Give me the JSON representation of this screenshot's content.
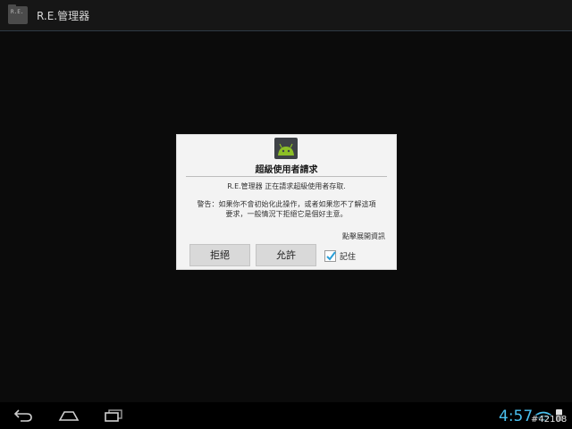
{
  "app": {
    "title": "R.E.管理器",
    "icon_text": "R.E."
  },
  "dialog": {
    "title": "超級使用者請求",
    "message": "R.E.管理器 正在請求超級使用者存取.",
    "warning_line1": "警告：如果你不會初始化此操作，或者如果您不了解這項",
    "warning_line2": "要求，一般情況下拒絕它是個好主意。",
    "details_link": "點擊展開資訊",
    "deny_label": "拒絕",
    "allow_label": "允許",
    "remember_label": "記住",
    "remember_checked": true
  },
  "status": {
    "time": "4:57"
  },
  "watermark": "#42108",
  "colors": {
    "clock": "#4ac0ee",
    "android_green": "#8cbf26"
  },
  "icons": {
    "app": "folder-icon",
    "dialog": "android-icon",
    "back": "back-icon",
    "home": "home-icon",
    "recents": "recents-icon",
    "wifi": "wifi-icon",
    "battery": "battery-icon",
    "checkbox": "checkmark-icon"
  }
}
